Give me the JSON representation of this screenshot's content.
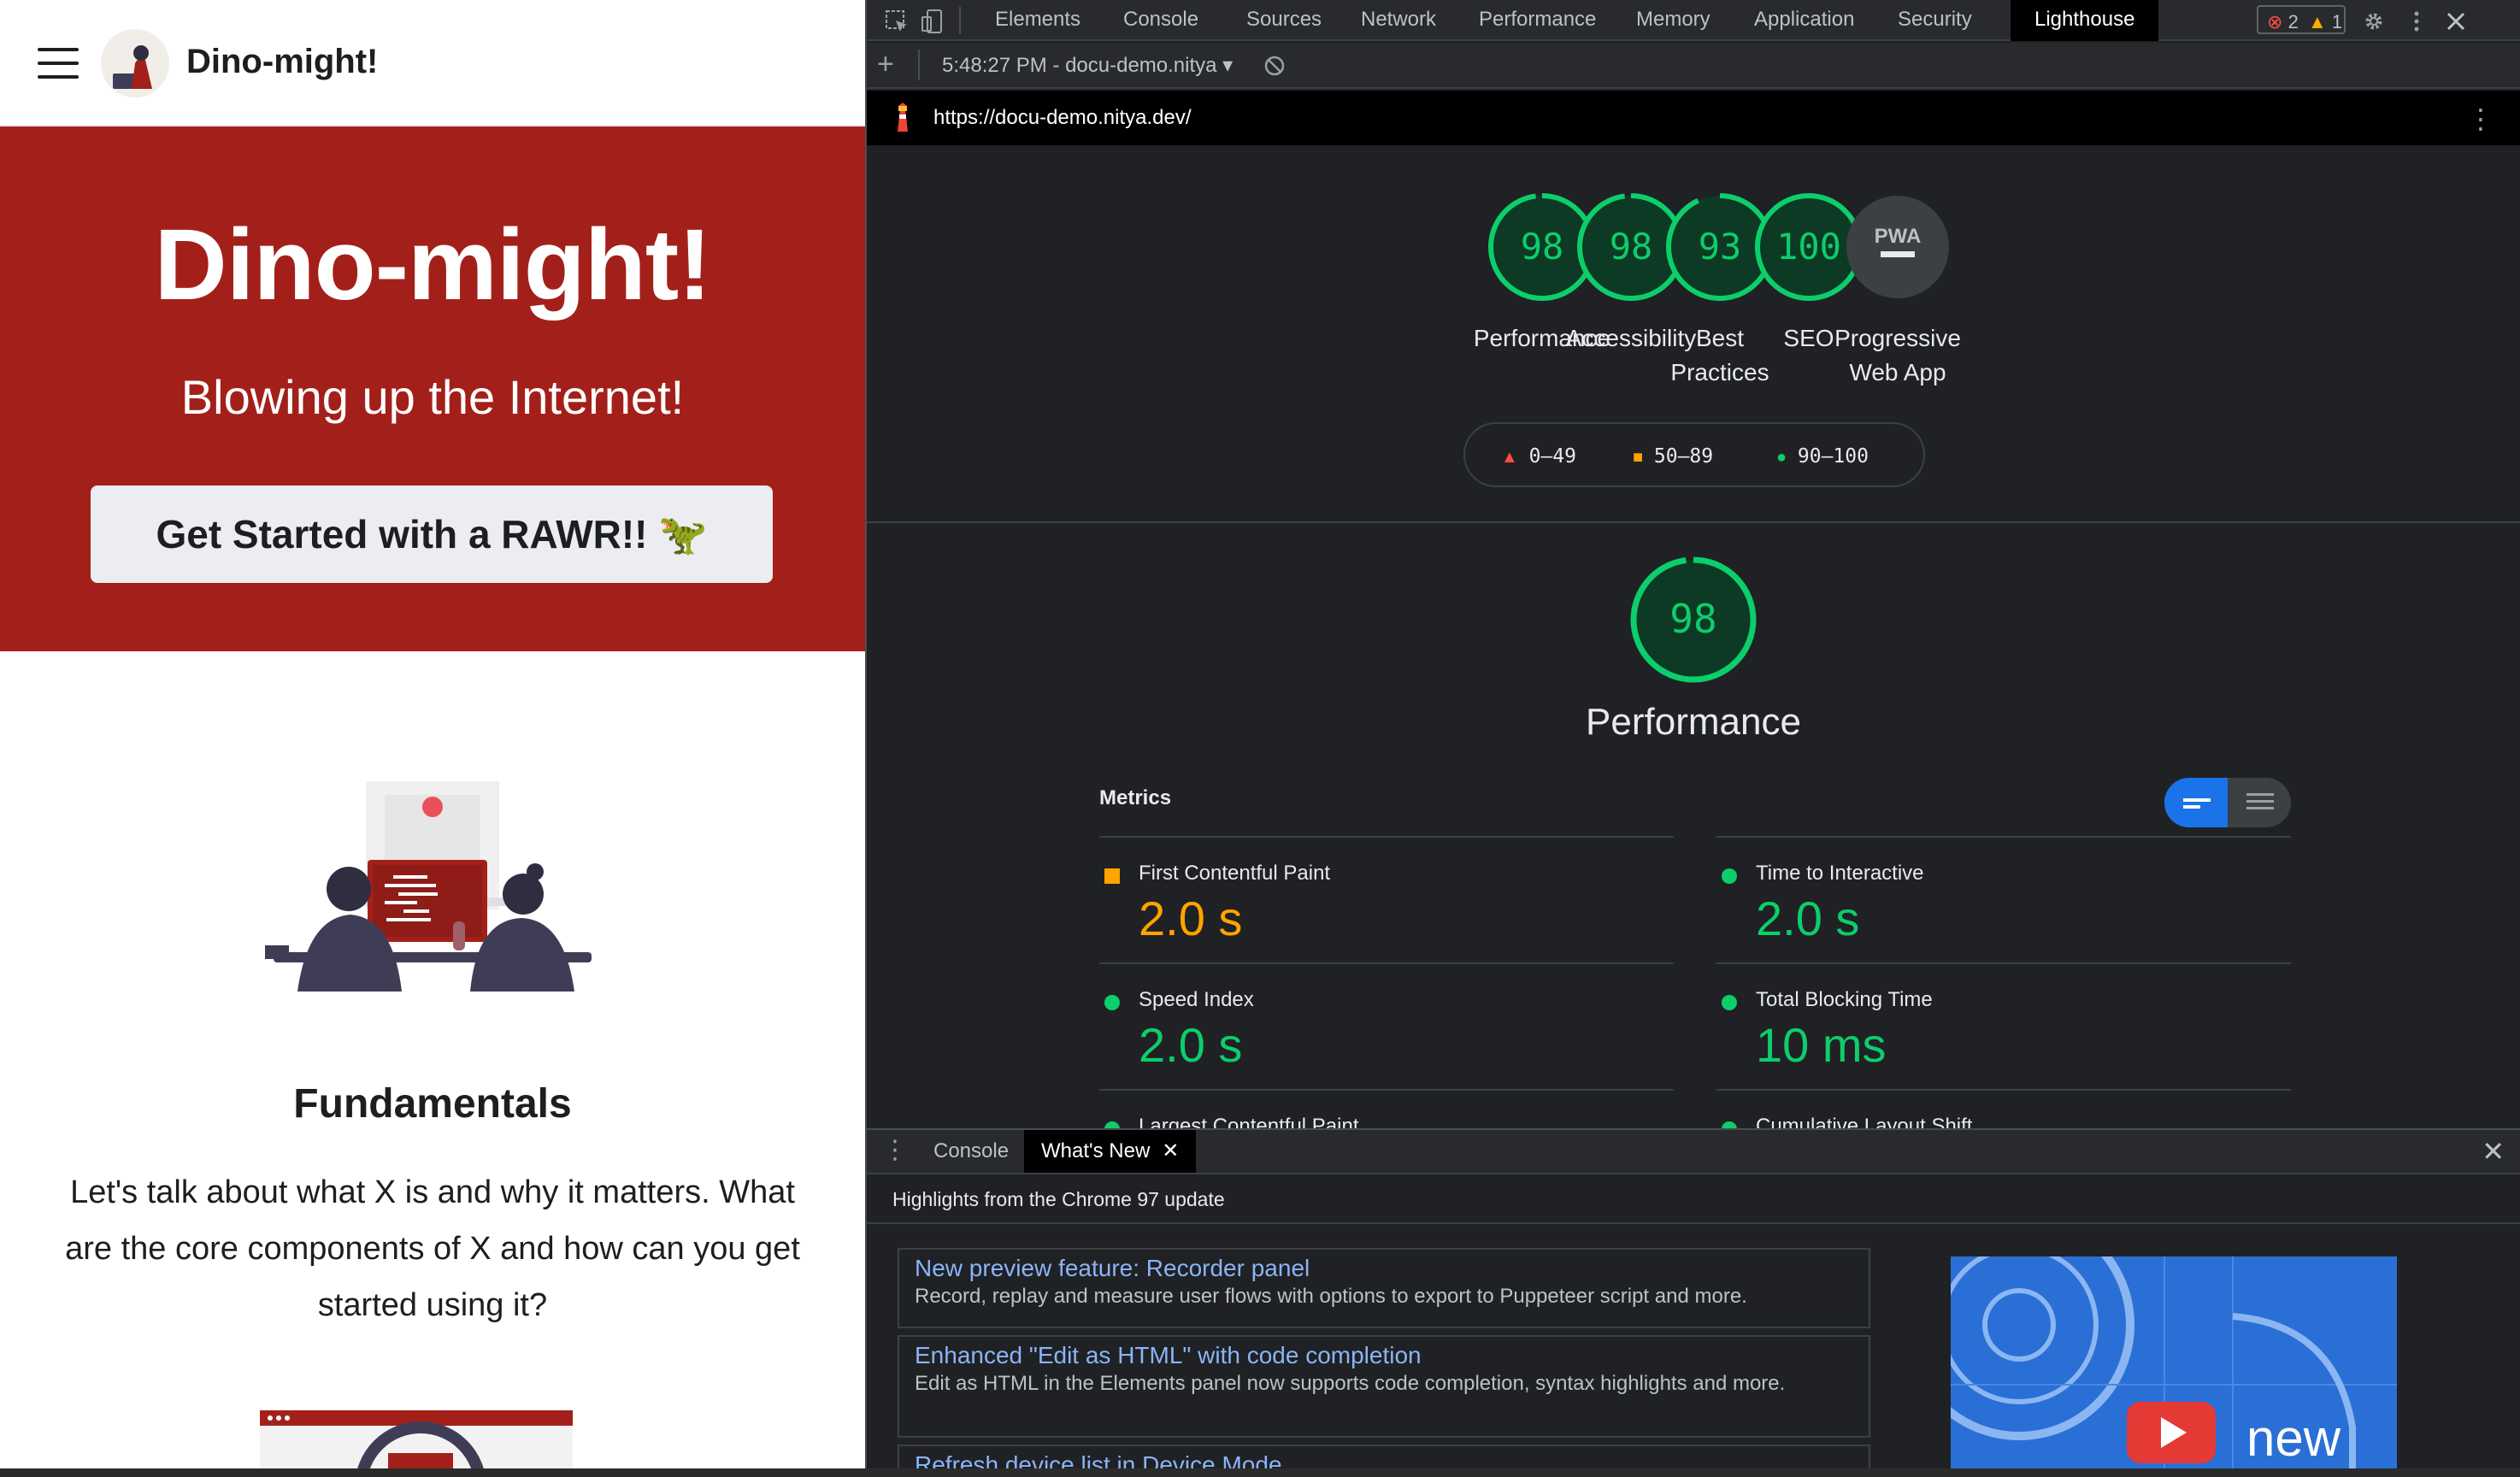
{
  "site": {
    "brand": "Dino-might!",
    "hero_title": "Dino-might!",
    "hero_tagline": "Blowing up the Internet!",
    "hero_button": "Get Started with a RAWR!! 🦖",
    "section_title": "Fundamentals",
    "section_text": "Let's talk about what X is and why it matters. What are the core components of X and how can you get started using it?",
    "colors": {
      "hero_bg": "#a3201a"
    }
  },
  "devtools": {
    "tabs": [
      "Elements",
      "Console",
      "Sources",
      "Network",
      "Performance",
      "Memory",
      "Application",
      "Security",
      "Lighthouse"
    ],
    "active_tab": "Lighthouse",
    "error_count": "2",
    "warning_count": "1",
    "toolbar": {
      "add_label": "+",
      "report_select": "5:48:27 PM - docu-demo.nitya ▾"
    },
    "url": "https://docu-demo.nitya.dev/",
    "scores": [
      {
        "label": "Performance",
        "value": "98",
        "fraction": 0.98
      },
      {
        "label": "Accessibility",
        "value": "98",
        "fraction": 0.98
      },
      {
        "label": "Best Practices",
        "value": "93",
        "fraction": 0.93
      },
      {
        "label": "SEO",
        "value": "100",
        "fraction": 1.0
      },
      {
        "label": "Progressive Web App",
        "value": "PWA",
        "fraction": 0
      }
    ],
    "legend": {
      "fail": "0–49",
      "average": "50–89",
      "pass": "90–100"
    },
    "colors": {
      "pass": "#0cce6b",
      "average": "#ffa400",
      "fail": "#ff4e42",
      "accent": "#1a73e8"
    },
    "category": {
      "title": "Performance",
      "score": "98",
      "fraction": 0.98
    },
    "metrics_label": "Metrics",
    "metrics": [
      {
        "label": "First Contentful Paint",
        "value": "2.0 s",
        "status": "average"
      },
      {
        "label": "Time to Interactive",
        "value": "2.0 s",
        "status": "pass"
      },
      {
        "label": "Speed Index",
        "value": "2.0 s",
        "status": "pass"
      },
      {
        "label": "Total Blocking Time",
        "value": "10 ms",
        "status": "pass"
      },
      {
        "label": "Largest Contentful Paint",
        "value": "",
        "status": "pass"
      },
      {
        "label": "Cumulative Layout Shift",
        "value": "",
        "status": "pass"
      }
    ],
    "drawer": {
      "tabs": [
        "Console",
        "What's New"
      ],
      "active_tab": "What's New",
      "header": "Highlights from the Chrome 97 update",
      "items": [
        {
          "title": "New preview feature: Recorder panel",
          "desc": "Record, replay and measure user flows with options to export to Puppeteer script and more."
        },
        {
          "title": "Enhanced \"Edit as HTML\" with code completion",
          "desc": "Edit as HTML in the Elements panel now supports code completion, syntax highlights and more."
        },
        {
          "title": "Refresh device list in Device Mode",
          "desc": ""
        }
      ],
      "video_caption": "new"
    }
  }
}
